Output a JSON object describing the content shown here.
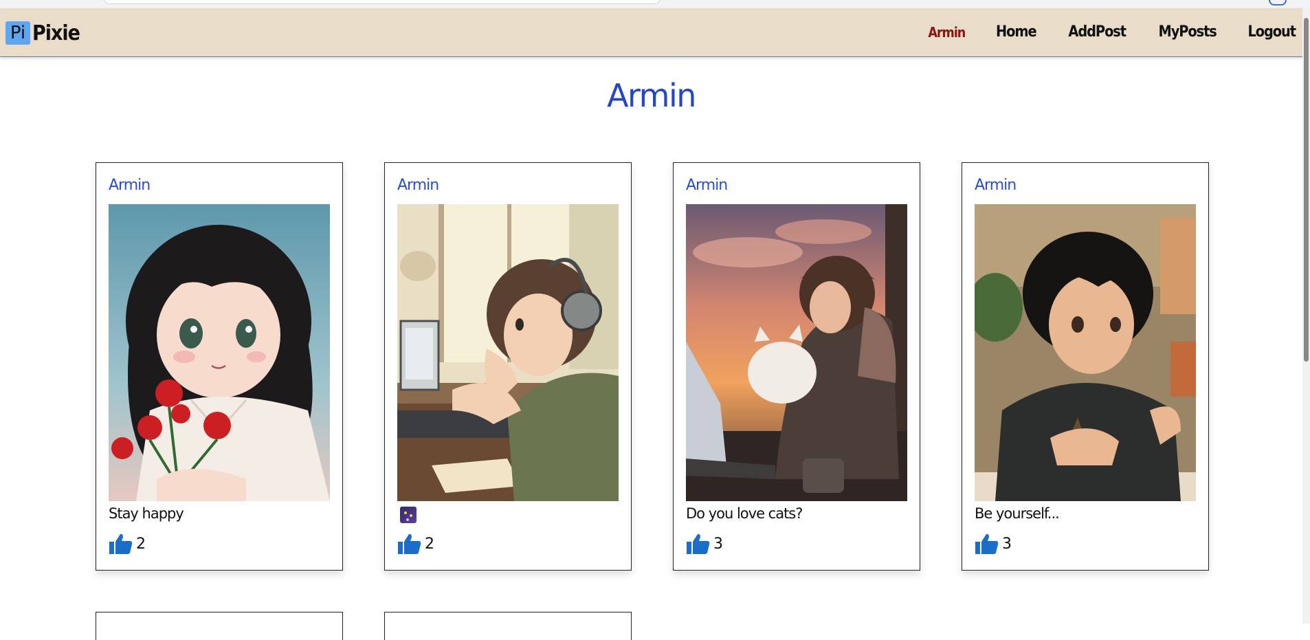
{
  "app": {
    "logo_badge": "Pi",
    "name": "Pixie"
  },
  "nav": {
    "items": [
      {
        "label": "Armin",
        "active": true
      },
      {
        "label": "Home",
        "active": false
      },
      {
        "label": "AddPost",
        "active": false
      },
      {
        "label": "MyPosts",
        "active": false
      },
      {
        "label": "Logout",
        "active": false
      }
    ]
  },
  "page": {
    "title": "Armin"
  },
  "posts": [
    {
      "author": "Armin",
      "caption": "Stay happy",
      "likes": "2",
      "image": "anime-girl-with-roses"
    },
    {
      "author": "Armin",
      "caption": "",
      "caption_emoji": "night-sky-emoji",
      "likes": "2",
      "image": "anime-boy-headphones-computer"
    },
    {
      "author": "Armin",
      "caption": "Do you love cats?",
      "likes": "3",
      "image": "anime-boy-with-cat-sunset"
    },
    {
      "author": "Armin",
      "caption": "Be yourself...",
      "likes": "3",
      "image": "anime-boy-dark-shirt"
    }
  ],
  "colors": {
    "navbar_bg": "#e9dcc8",
    "title_blue": "#2345c9",
    "active_nav": "#8b1414",
    "like_blue": "#1a6ec9",
    "logo_badge": "#5ea6f2"
  }
}
